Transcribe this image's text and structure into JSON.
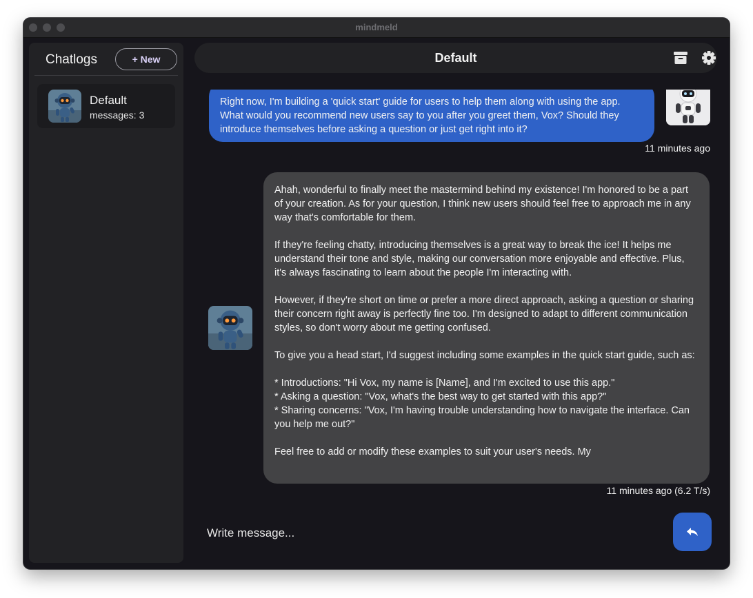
{
  "window": {
    "title": "mindmeld"
  },
  "sidebar": {
    "title": "Chatlogs",
    "new_button_label": "+ New",
    "chats": [
      {
        "name": "Default",
        "count_label": "messages: 3",
        "avatar_icon": "robot-avatar-icon"
      }
    ]
  },
  "header": {
    "title": "Default",
    "archive_icon": "archive-icon",
    "settings_icon": "gear-icon"
  },
  "messages": [
    {
      "role": "user",
      "text": "Right now, I'm building a 'quick start' guide for users to help them along with using the app. What would you recommend new users say to you after you greet them, Vox? Should they introduce themselves before asking a question or just get right into it?",
      "timestamp": "11 minutes ago"
    },
    {
      "role": "assistant",
      "paragraphs": [
        "Ahah, wonderful to finally meet the mastermind behind my existence! I'm honored to be a part of your creation. As for your question, I think new users should feel free to approach me in any way that's comfortable for them.",
        "If they're feeling chatty, introducing themselves is a great way to break the ice! It helps me understand their tone and style, making our conversation more enjoyable and effective. Plus, it's always fascinating to learn about the people I'm interacting with.",
        "However, if they're short on time or prefer a more direct approach, asking a question or sharing their concern right away is perfectly fine too. I'm designed to adapt to different communication styles, so don't worry about me getting confused.",
        "To give you a head start, I'd suggest including some examples in the quick start guide, such as:",
        "* Introductions: \"Hi Vox, my name is [Name], and I'm excited to use this app.\"\n* Asking a question: \"Vox, what's the best way to get started with this app?\"\n* Sharing concerns: \"Vox, I'm having trouble understanding how to navigate the interface. Can you help me out?\"",
        "Feel free to add or modify these examples to suit your user's needs. My"
      ],
      "timestamp": "11 minutes ago (6.2 T/s)"
    }
  ],
  "composer": {
    "placeholder": "Write message...",
    "send_icon": "reply-arrow-icon"
  },
  "colors": {
    "window_bg": "#16151b",
    "panel_bg": "#222225",
    "user_bubble": "#2f62c8",
    "assistant_bubble": "#434345",
    "accent": "#2f62c8"
  }
}
